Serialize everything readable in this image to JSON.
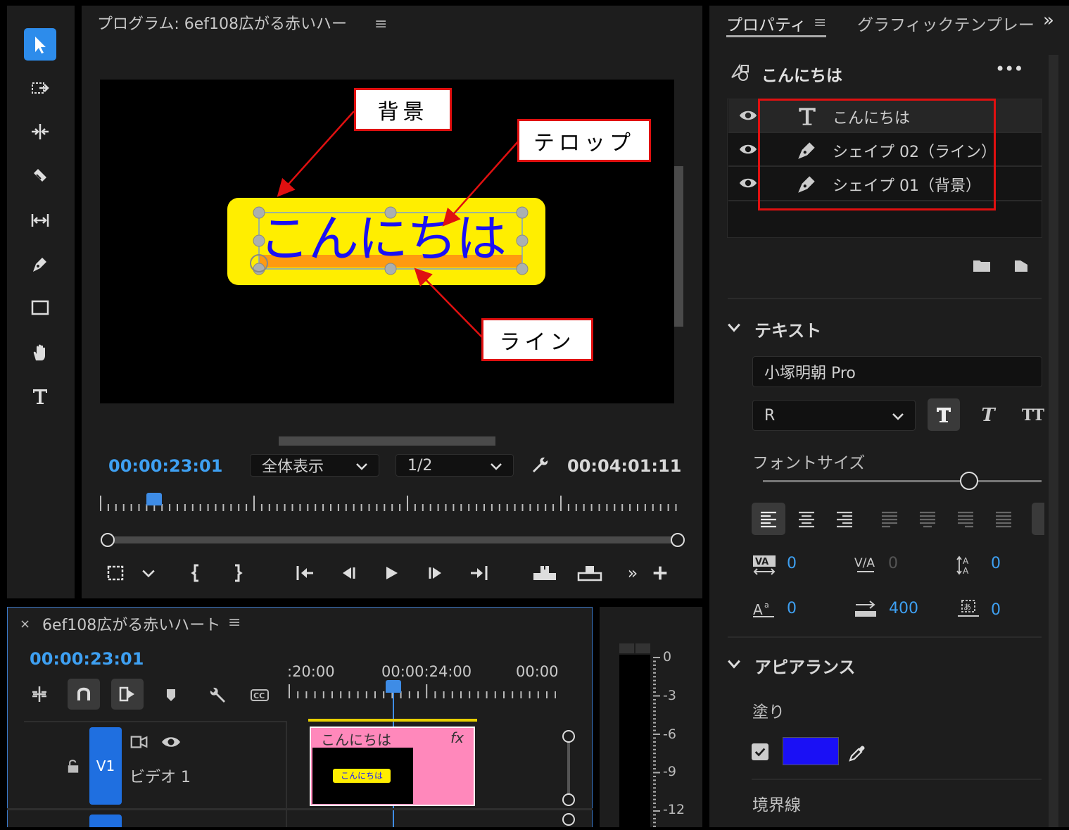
{
  "program_monitor": {
    "title": "プログラム: 6ef108広がる赤いハー",
    "timecode_current": "00:00:23:01",
    "timecode_duration": "00:04:01:11",
    "zoom_select": "全体表示",
    "resolution_select": "1/2",
    "preview_text": "こんにちは"
  },
  "callouts": {
    "background": "背景",
    "telop": "テロップ",
    "line": "ライン"
  },
  "properties": {
    "tab_properties": "プロパティ",
    "tab_graphics": "グラフィックテンプレー",
    "object_name": "こんにちは",
    "layers": [
      {
        "label": "こんにちは",
        "icon": "text-icon"
      },
      {
        "label": "シェイプ 02（ライン）",
        "icon": "pen-icon"
      },
      {
        "label": "シェイプ 01（背景）",
        "icon": "pen-icon"
      }
    ],
    "text_section": "テキスト",
    "font_family": "小塚明朝 Pro",
    "font_style": "R",
    "font_size_label": "フォントサイズ",
    "kerning": "0",
    "tracking": "0",
    "leading": "0",
    "baseline": "0",
    "tsume": "400",
    "tab_spacing": "0",
    "appearance_section": "アピアランス",
    "fill_label": "塗り",
    "fill_color": "#1a10f5",
    "stroke_label": "境界線"
  },
  "timeline": {
    "title": "6ef108広がる赤いハート",
    "timecode": "00:00:23:01",
    "ruler_labels": [
      ":20:00",
      "00:00:24:00",
      "00:00"
    ],
    "track_name": "V1",
    "track_label": "ビデオ 1",
    "clip_title": "こんにちは",
    "clip_fx": "fx",
    "clip_thumb_text": "こんにちは"
  },
  "audio_meter": {
    "labels": [
      "0",
      "-3",
      "-6",
      "-9",
      "-12"
    ]
  }
}
